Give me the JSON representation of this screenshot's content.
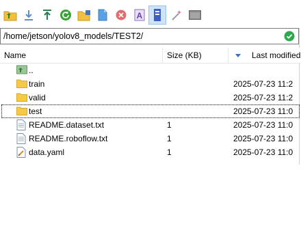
{
  "toolbar": {
    "buttons": [
      {
        "icon": "parent-folder-icon"
      },
      {
        "icon": "download-icon"
      },
      {
        "icon": "upload-icon"
      },
      {
        "icon": "refresh-icon"
      },
      {
        "icon": "new-folder-icon"
      },
      {
        "icon": "new-file-icon"
      },
      {
        "icon": "delete-icon"
      },
      {
        "icon": "rename-icon"
      },
      {
        "icon": "properties-icon",
        "active": true
      },
      {
        "icon": "find-icon"
      },
      {
        "icon": "terminal-icon"
      }
    ]
  },
  "path": {
    "value": "/home/jetson/yolov8_models/TEST2/"
  },
  "columns": {
    "name": "Name",
    "size": "Size (KB)",
    "modified": "Last modified"
  },
  "files": [
    {
      "name": "..",
      "size": "",
      "modified": "",
      "icon": "parent-folder-icon"
    },
    {
      "name": "train",
      "size": "",
      "modified": "2025-07-23 11:2",
      "icon": "folder-icon"
    },
    {
      "name": "valid",
      "size": "",
      "modified": "2025-07-23 11:2",
      "icon": "folder-icon"
    },
    {
      "name": "test",
      "size": "",
      "modified": "2025-07-23 11:0",
      "icon": "folder-icon"
    },
    {
      "name": "README.dataset.txt",
      "size": "1",
      "modified": "2025-07-23 11:0",
      "icon": "text-file-icon"
    },
    {
      "name": "README.roboflow.txt",
      "size": "1",
      "modified": "2025-07-23 11:0",
      "icon": "text-file-icon"
    },
    {
      "name": "data.yaml",
      "size": "1",
      "modified": "2025-07-23 11:0",
      "icon": "yaml-file-icon"
    }
  ],
  "colors": {
    "folder": "#f7c948",
    "accent": "#2e8b57",
    "selected_bg": "#cfe3f7"
  }
}
